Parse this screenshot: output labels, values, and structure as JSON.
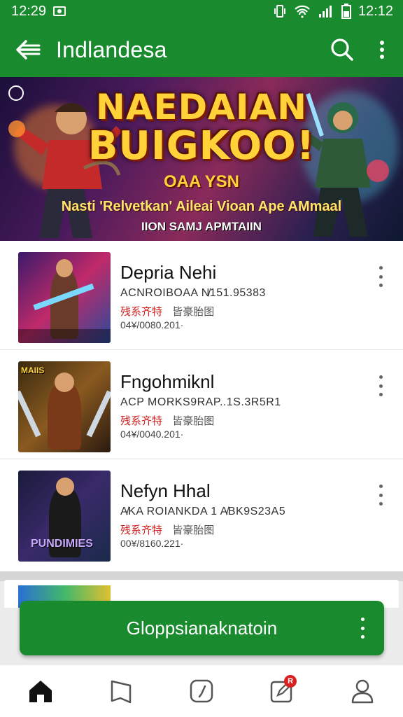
{
  "status_bar": {
    "time_left": "12:29",
    "time_right": "12:12"
  },
  "app_bar": {
    "title": "Indlandesa",
    "back_icon": "arrow-left-icon",
    "search_icon": "search-icon",
    "menu_icon": "more-vert-icon"
  },
  "banner": {
    "line1": "NAEDAIAN",
    "line2": "BUIGKOO!",
    "line3": "OAA YSN",
    "line4": "Nasti 'Relvetkan' Aileai Vioan Ape AMmaal",
    "line5": "IION SAMJ APMTAIIN"
  },
  "list": {
    "items": [
      {
        "title": "Depria Nehi",
        "subtitle": "ACNROIBOAA N̸151.95383",
        "tag_red": "残系齐特",
        "tag_gray": "皆豪胎图",
        "date": "04¥/0080.201·"
      },
      {
        "title": "Fngohmiknl",
        "subtitle": "ACP MORKS9RAP..1S.3R5R1",
        "tag_red": "残系齐特",
        "tag_gray": "皆豪胎图",
        "date": "04¥/0040.201·"
      },
      {
        "title": "Nefyn Hhal",
        "subtitle": "A̸KA ROIANKDA 1 A̸BK9S23A5",
        "tag_red": "残系齐特",
        "tag_gray": "皆豪胎图",
        "date": "00¥/8160.221·"
      }
    ],
    "thumb_tags": [
      "",
      "MAIIS",
      "PUNDIMIES"
    ]
  },
  "cta": {
    "label": "Gloppsianaknatoin"
  },
  "bottom_nav": {
    "badge": "R"
  }
}
